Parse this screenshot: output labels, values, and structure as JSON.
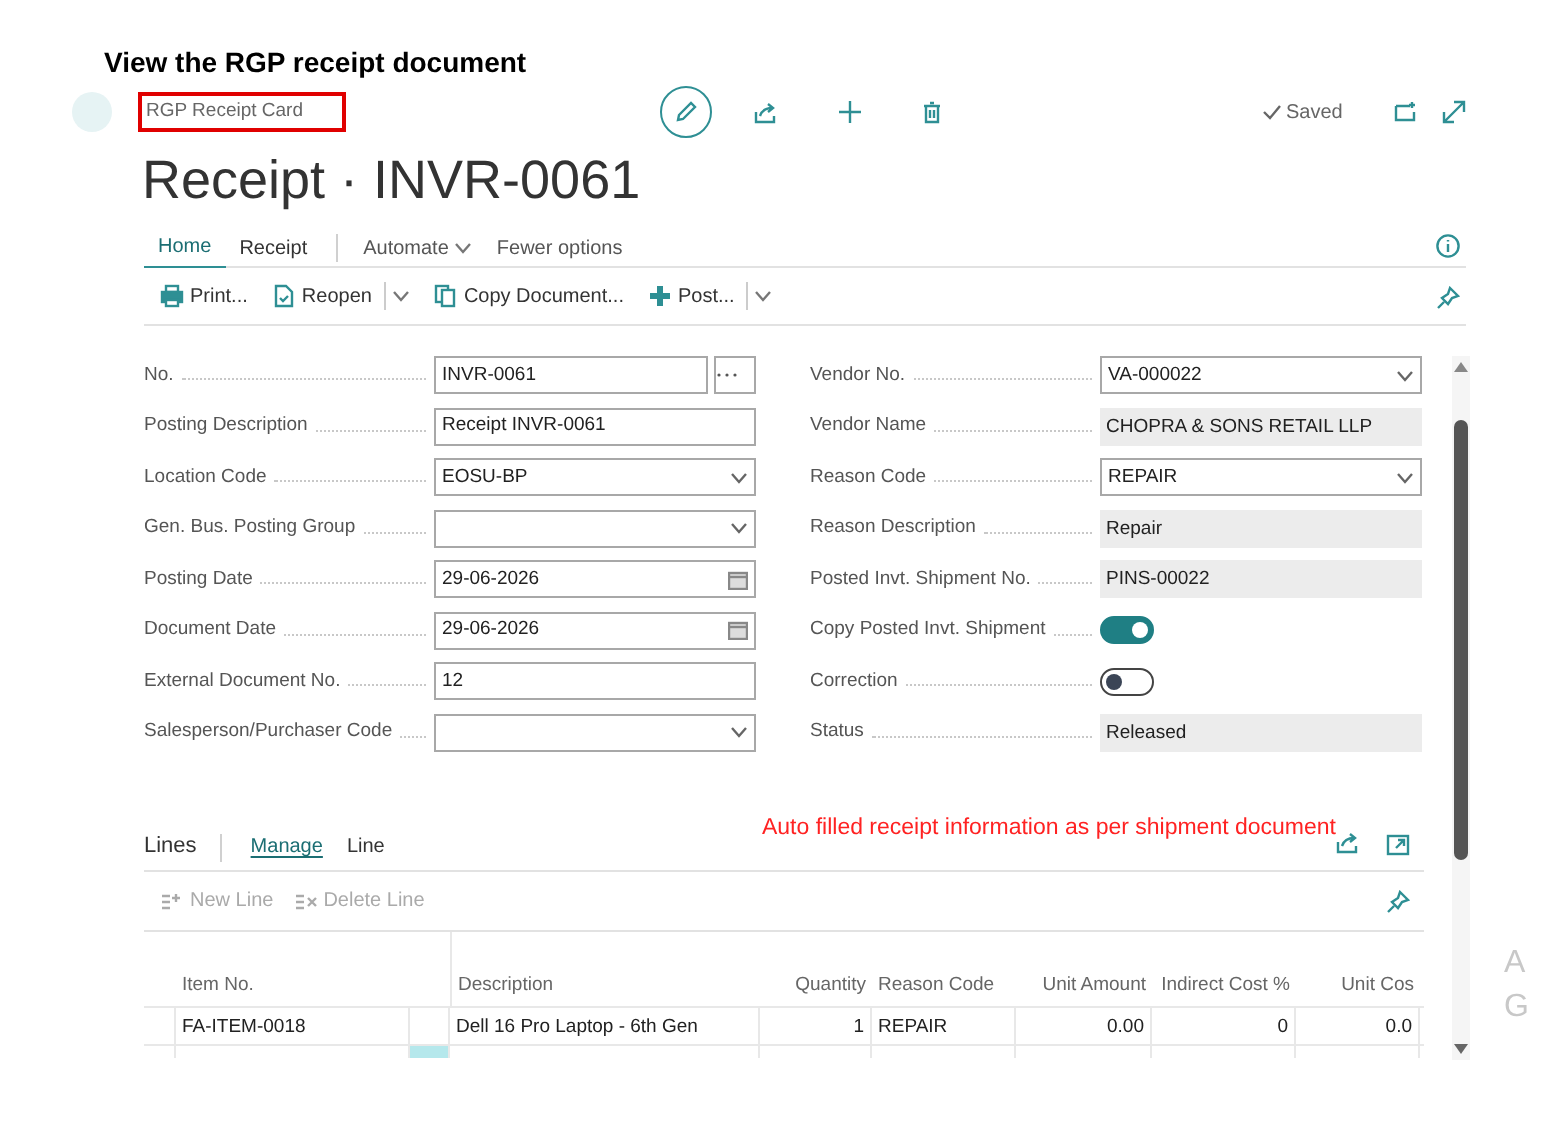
{
  "caption": "View the RGP receipt document",
  "breadcrumb": "RGP Receipt Card",
  "save_state": "Saved",
  "title": "Receipt · INVR-0061",
  "tabs": [
    {
      "label": "Home",
      "selected": true
    },
    {
      "label": "Receipt",
      "selected": false
    }
  ],
  "menus": [
    "Automate",
    "Fewer options"
  ],
  "actions": [
    {
      "label": "Print...",
      "kind": "print",
      "split": false
    },
    {
      "label": "Reopen",
      "kind": "reopen",
      "split": true
    },
    {
      "label": "Copy Document...",
      "kind": "copy",
      "split": false
    },
    {
      "label": "Post...",
      "kind": "post",
      "split": true
    }
  ],
  "left_fields": [
    {
      "label": "No.",
      "kind": "lookup",
      "value": "INVR-0061"
    },
    {
      "label": "Posting Description",
      "kind": "text",
      "value": "Receipt INVR-0061"
    },
    {
      "label": "Location Code",
      "kind": "dropdown",
      "value": "EOSU-BP"
    },
    {
      "label": "Gen. Bus. Posting Group",
      "kind": "dropdown"
    },
    {
      "label": "Posting Date",
      "kind": "date",
      "value": "29-06-2026"
    },
    {
      "label": "Document Date",
      "kind": "date",
      "value": "29-06-2026"
    },
    {
      "label": "External Document No.",
      "kind": "text",
      "value": "12"
    },
    {
      "label": "Salesperson/Purchaser Code",
      "kind": "dropdown"
    }
  ],
  "right_fields": [
    {
      "label": "Vendor No.",
      "kind": "dropdown",
      "value": "VA-000022"
    },
    {
      "label": "Vendor Name",
      "kind": "readonly",
      "value": "CHOPRA & SONS RETAIL LLP"
    },
    {
      "label": "Reason Code",
      "kind": "dropdown",
      "value": "REPAIR"
    },
    {
      "label": "Reason Description",
      "kind": "readonly",
      "value": "Repair"
    },
    {
      "label": "Posted Invt. Shipment No.",
      "kind": "readonly",
      "value": "PINS-00022"
    },
    {
      "label": "Copy Posted Invt. Shipment",
      "kind": "toggle",
      "on": true
    },
    {
      "label": "Correction",
      "kind": "toggle",
      "on": false
    },
    {
      "label": "Status",
      "kind": "readonly",
      "value": "Released"
    }
  ],
  "lines": {
    "title": "Lines",
    "tabs": [
      {
        "label": "Manage",
        "selected": true
      },
      {
        "label": "Line",
        "selected": false
      }
    ],
    "actions": [
      {
        "label": "New Line",
        "kind": "new",
        "disabled": true
      },
      {
        "label": "Delete Line",
        "kind": "delete",
        "disabled": true
      }
    ],
    "columns": [
      "Item No.",
      "Description",
      "Quantity",
      "Reason Code",
      "Unit Amount",
      "Indirect Cost %",
      "Unit Cos"
    ],
    "rows": [
      [
        "FA-ITEM-0018",
        "Dell 16 Pro Laptop - 6th Gen",
        "1",
        "REPAIR",
        "0.00",
        "0",
        "0.0"
      ]
    ]
  },
  "annotation": "Auto filled receipt information as per shipment document",
  "side_fragments": [
    "A",
    "G"
  ]
}
